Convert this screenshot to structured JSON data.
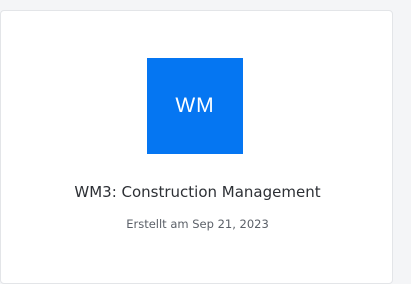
{
  "course_card": {
    "avatar_initials": "WM",
    "avatar_color": "#0576f2",
    "title": "WM3: Construction Management",
    "created_label": "Erstellt am Sep 21, 2023"
  }
}
